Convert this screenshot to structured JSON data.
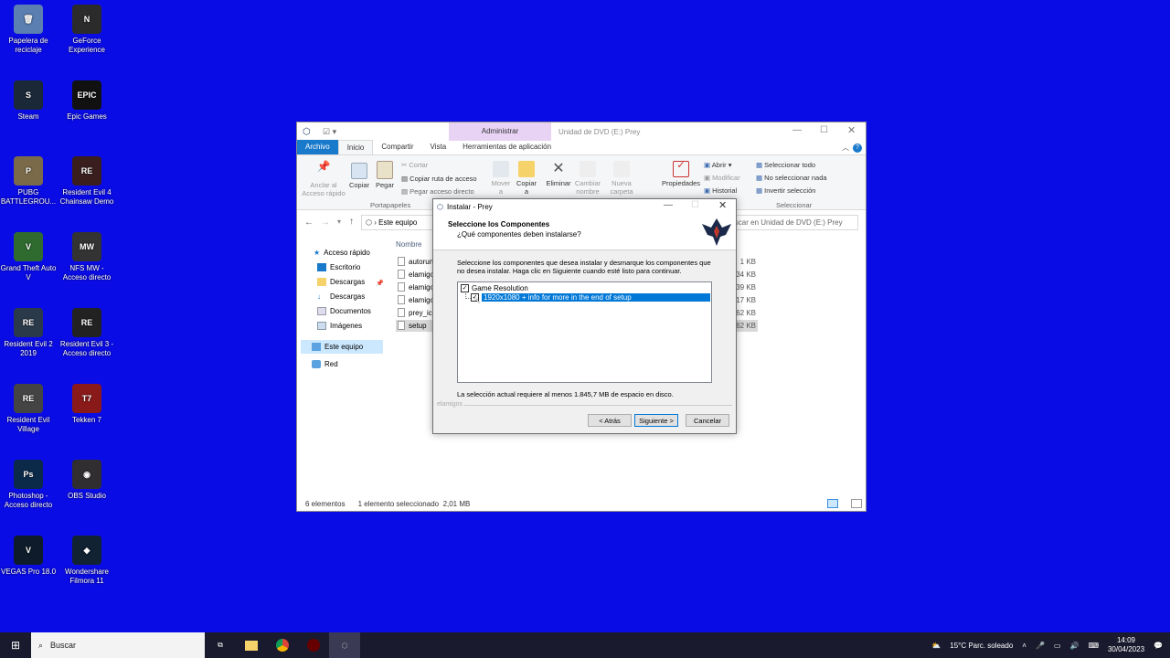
{
  "desktop_icons": [
    {
      "label": "Papelera de reciclaje",
      "icon": "recycle-bin-icon",
      "color": "#5a7fb0",
      "glyph": "🗑"
    },
    {
      "label": "GeForce Experience",
      "icon": "nvidia-icon",
      "color": "#2b2b2b",
      "glyph": "N"
    },
    {
      "label": "Steam",
      "icon": "steam-icon",
      "color": "#1b2838",
      "glyph": "S"
    },
    {
      "label": "Epic Games",
      "icon": "epic-games-icon",
      "color": "#111",
      "glyph": "EPIC"
    },
    {
      "label": "PUBG BATTLEGROU...",
      "icon": "pubg-icon",
      "color": "#7a6a4a",
      "glyph": "P"
    },
    {
      "label": "Resident Evil 4 Chainsaw Demo",
      "icon": "re4-icon",
      "color": "#3a1e1e",
      "glyph": "RE"
    },
    {
      "label": "Grand Theft Auto V",
      "icon": "gta-icon",
      "color": "#2f6b2f",
      "glyph": "V"
    },
    {
      "label": "NFS MW - Acceso directo",
      "icon": "nfs-icon",
      "color": "#333",
      "glyph": "MW"
    },
    {
      "label": "Resident Evil 2 2019",
      "icon": "re2-icon",
      "color": "#2a3a4a",
      "glyph": "RE"
    },
    {
      "label": "Resident Evil 3 - Acceso directo",
      "icon": "re3-icon",
      "color": "#222",
      "glyph": "RE"
    },
    {
      "label": "Resident Evil Village",
      "icon": "re-village-icon",
      "color": "#444",
      "glyph": "RE"
    },
    {
      "label": "Tekken 7",
      "icon": "tekken-icon",
      "color": "#8a1a1a",
      "glyph": "T7"
    },
    {
      "label": "Photoshop - Acceso directo",
      "icon": "photoshop-icon",
      "color": "#0b2a4a",
      "glyph": "Ps"
    },
    {
      "label": "OBS Studio",
      "icon": "obs-icon",
      "color": "#302e31",
      "glyph": "◉"
    },
    {
      "label": "VEGAS Pro 18.0",
      "icon": "vegas-icon",
      "color": "#0d1b2a",
      "glyph": "V"
    },
    {
      "label": "Wondershare Filmora 11",
      "icon": "filmora-icon",
      "color": "#123",
      "glyph": "◆"
    }
  ],
  "explorer": {
    "context_tab": "Administrar",
    "window_title": "Unidad de DVD (E:) Prey",
    "tabs": [
      "Archivo",
      "Inicio",
      "Compartir",
      "Vista",
      "Herramientas de aplicación"
    ],
    "ribbon": {
      "pin": "Anclar al Acceso rápido",
      "copy": "Copiar",
      "paste": "Pegar",
      "cut": "Cortar",
      "copy_path": "Copiar ruta de acceso",
      "paste_shortcut": "Pegar acceso directo",
      "move": "Mover a",
      "copy_to": "Copiar a",
      "delete": "Eliminar",
      "rename": "Cambiar nombre",
      "new_folder": "Nueva carpeta",
      "properties": "Propiedades",
      "open": "Abrir",
      "modify": "Modificar",
      "history": "Historial",
      "select_all": "Seleccionar todo",
      "select_none": "No seleccionar nada",
      "invert": "Invertir selección",
      "group_clipboard": "Portapapeles",
      "group_select": "Seleccionar"
    },
    "address": "Este equipo",
    "search_placeholder": "Buscar en Unidad de DVD (E:) Prey",
    "nav": {
      "quick": "Acceso rápido",
      "desktop": "Escritorio",
      "downloads1": "Descargas",
      "downloads2": "Descargas",
      "documents": "Documentos",
      "images": "Imágenes",
      "this_pc": "Este equipo",
      "network": "Red"
    },
    "column_name": "Nombre",
    "files": [
      {
        "name": "autorun",
        "size": "1 KB"
      },
      {
        "name": "elamigos",
        "size": "34 KB"
      },
      {
        "name": "elamigos",
        "size": "639 KB"
      },
      {
        "name": "elamigos",
        "size": "417 KB"
      },
      {
        "name": "prey_icon",
        "size": "362 KB"
      },
      {
        "name": "setup",
        "size": "2.062 KB"
      }
    ],
    "status": {
      "count": "6 elementos",
      "selected": "1 elemento seleccionado",
      "size": "2,01 MB"
    }
  },
  "installer": {
    "title": "Instalar - Prey",
    "heading": "Seleccione los Componentes",
    "subheading": "¿Qué componentes deben instalarse?",
    "description": "Seleccione los componentes que desea instalar y desmarque los componentes que no desea instalar. Haga clic en Siguiente cuando esté listo para continuar.",
    "components": [
      {
        "label": "Game Resolution",
        "checked": true
      },
      {
        "label": "1920x1080 + info for more in the end of setup",
        "checked": true
      }
    ],
    "space": "La selección actual requiere al menos 1.845,7 MB de espacio en disco.",
    "brand": "elamigos",
    "back": "< Atrás",
    "next": "Siguiente >",
    "cancel": "Cancelar"
  },
  "taskbar": {
    "search": "Buscar",
    "weather": "15°C  Parc. soleado",
    "time": "14:09",
    "date": "30/04/2023"
  }
}
